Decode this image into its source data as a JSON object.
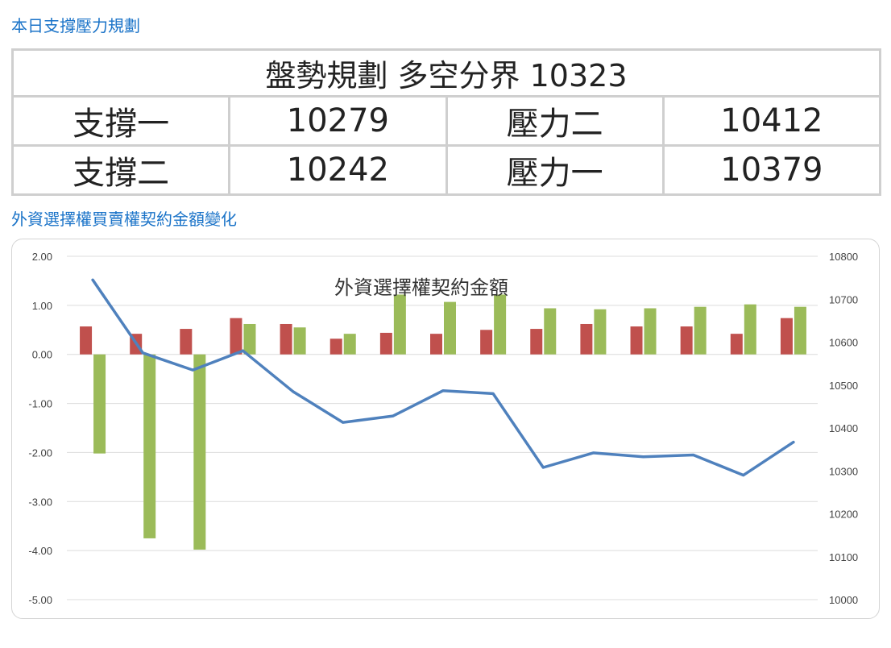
{
  "section1_title": "本日支撐壓力規劃",
  "table": {
    "header": "盤勢規劃 多空分界 10323",
    "rows": [
      {
        "label1": "支撐一",
        "value1": "10279",
        "label2": "壓力二",
        "value2": "10412"
      },
      {
        "label1": "支撐二",
        "value1": "10242",
        "label2": "壓力一",
        "value2": "10379"
      }
    ]
  },
  "section2_title": "外資選擇權買賣權契約金額變化",
  "colors": {
    "support": "#ff0000",
    "resistance": "#00a040",
    "red_bar": "#c0504d",
    "green_bar": "#9bbb59",
    "line": "#4f81bd",
    "section_title": "#1a73c8"
  },
  "chart_data": {
    "type": "bar",
    "title": "外資選擇權契約金額",
    "left_axis": {
      "min": -5,
      "max": 2,
      "ticks": [
        "2.00",
        "1.00",
        "0.00",
        "-1.00",
        "-2.00",
        "-3.00",
        "-4.00",
        "-5.00"
      ]
    },
    "right_axis": {
      "min": 10000,
      "max": 10800,
      "ticks": [
        "10800",
        "10700",
        "10600",
        "10500",
        "10400",
        "10300",
        "10200",
        "10100",
        "10000"
      ]
    },
    "grid": true,
    "series": [
      {
        "kind": "bar",
        "color": "#c0504d",
        "values": [
          0.57,
          0.42,
          0.52,
          0.74,
          0.62,
          0.32,
          0.44,
          0.42,
          0.5,
          0.52,
          0.62,
          0.57,
          0.57,
          0.42,
          0.74
        ]
      },
      {
        "kind": "bar",
        "color": "#9bbb59",
        "values": [
          -2.02,
          -3.75,
          -3.98,
          0.62,
          0.55,
          0.42,
          1.22,
          1.07,
          1.22,
          0.94,
          0.92,
          0.94,
          0.97,
          1.02,
          0.97
        ]
      },
      {
        "kind": "line",
        "color": "#4f81bd",
        "axis": "right",
        "values": [
          10745,
          10575,
          10535,
          10580,
          10485,
          10413,
          10428,
          10487,
          10480,
          10308,
          10342,
          10333,
          10337,
          10290,
          10367
        ]
      }
    ]
  }
}
